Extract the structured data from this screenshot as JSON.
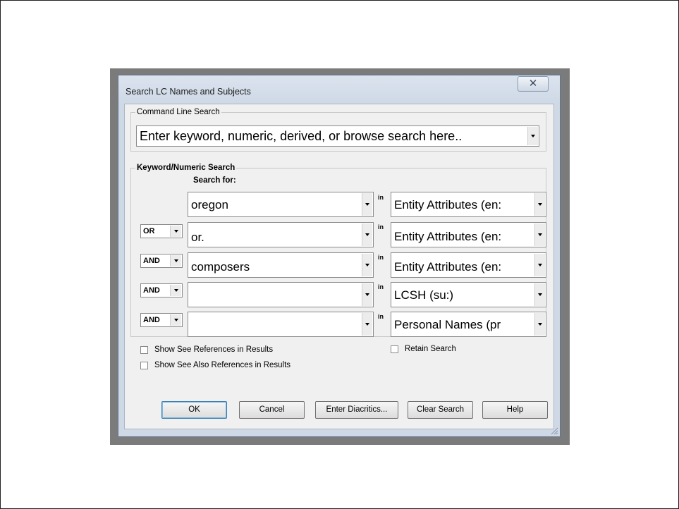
{
  "dialog": {
    "title": "Search LC Names and Subjects",
    "close_glyph": "✕"
  },
  "command_line": {
    "legend": "Command Line Search",
    "value": "Enter keyword, numeric, derived, or browse search here.."
  },
  "keyword": {
    "legend": "Keyword/Numeric Search",
    "search_for_label": "Search for:",
    "in_label": "in",
    "rows": [
      {
        "operator": "",
        "term": "oregon",
        "index": "Entity Attributes (en:"
      },
      {
        "operator": "OR",
        "term": "or.",
        "index": "Entity Attributes (en:"
      },
      {
        "operator": "AND",
        "term": "composers",
        "index": "Entity Attributes (en:"
      },
      {
        "operator": "AND",
        "term": "",
        "index": "LCSH (su:)"
      },
      {
        "operator": "AND",
        "term": "",
        "index": "Personal Names (pr"
      }
    ]
  },
  "options": {
    "show_see_refs": "Show See References in Results",
    "show_see_also_refs": "Show See Also References in Results",
    "retain_search": "Retain Search"
  },
  "buttons": {
    "ok": "OK",
    "cancel": "Cancel",
    "enter_diacritics": "Enter Diacritics...",
    "clear_search": "Clear Search",
    "help": "Help"
  },
  "icons": {
    "close": "close-icon",
    "dropdown": "chevron-down-icon",
    "resize": "resize-grip-icon"
  }
}
